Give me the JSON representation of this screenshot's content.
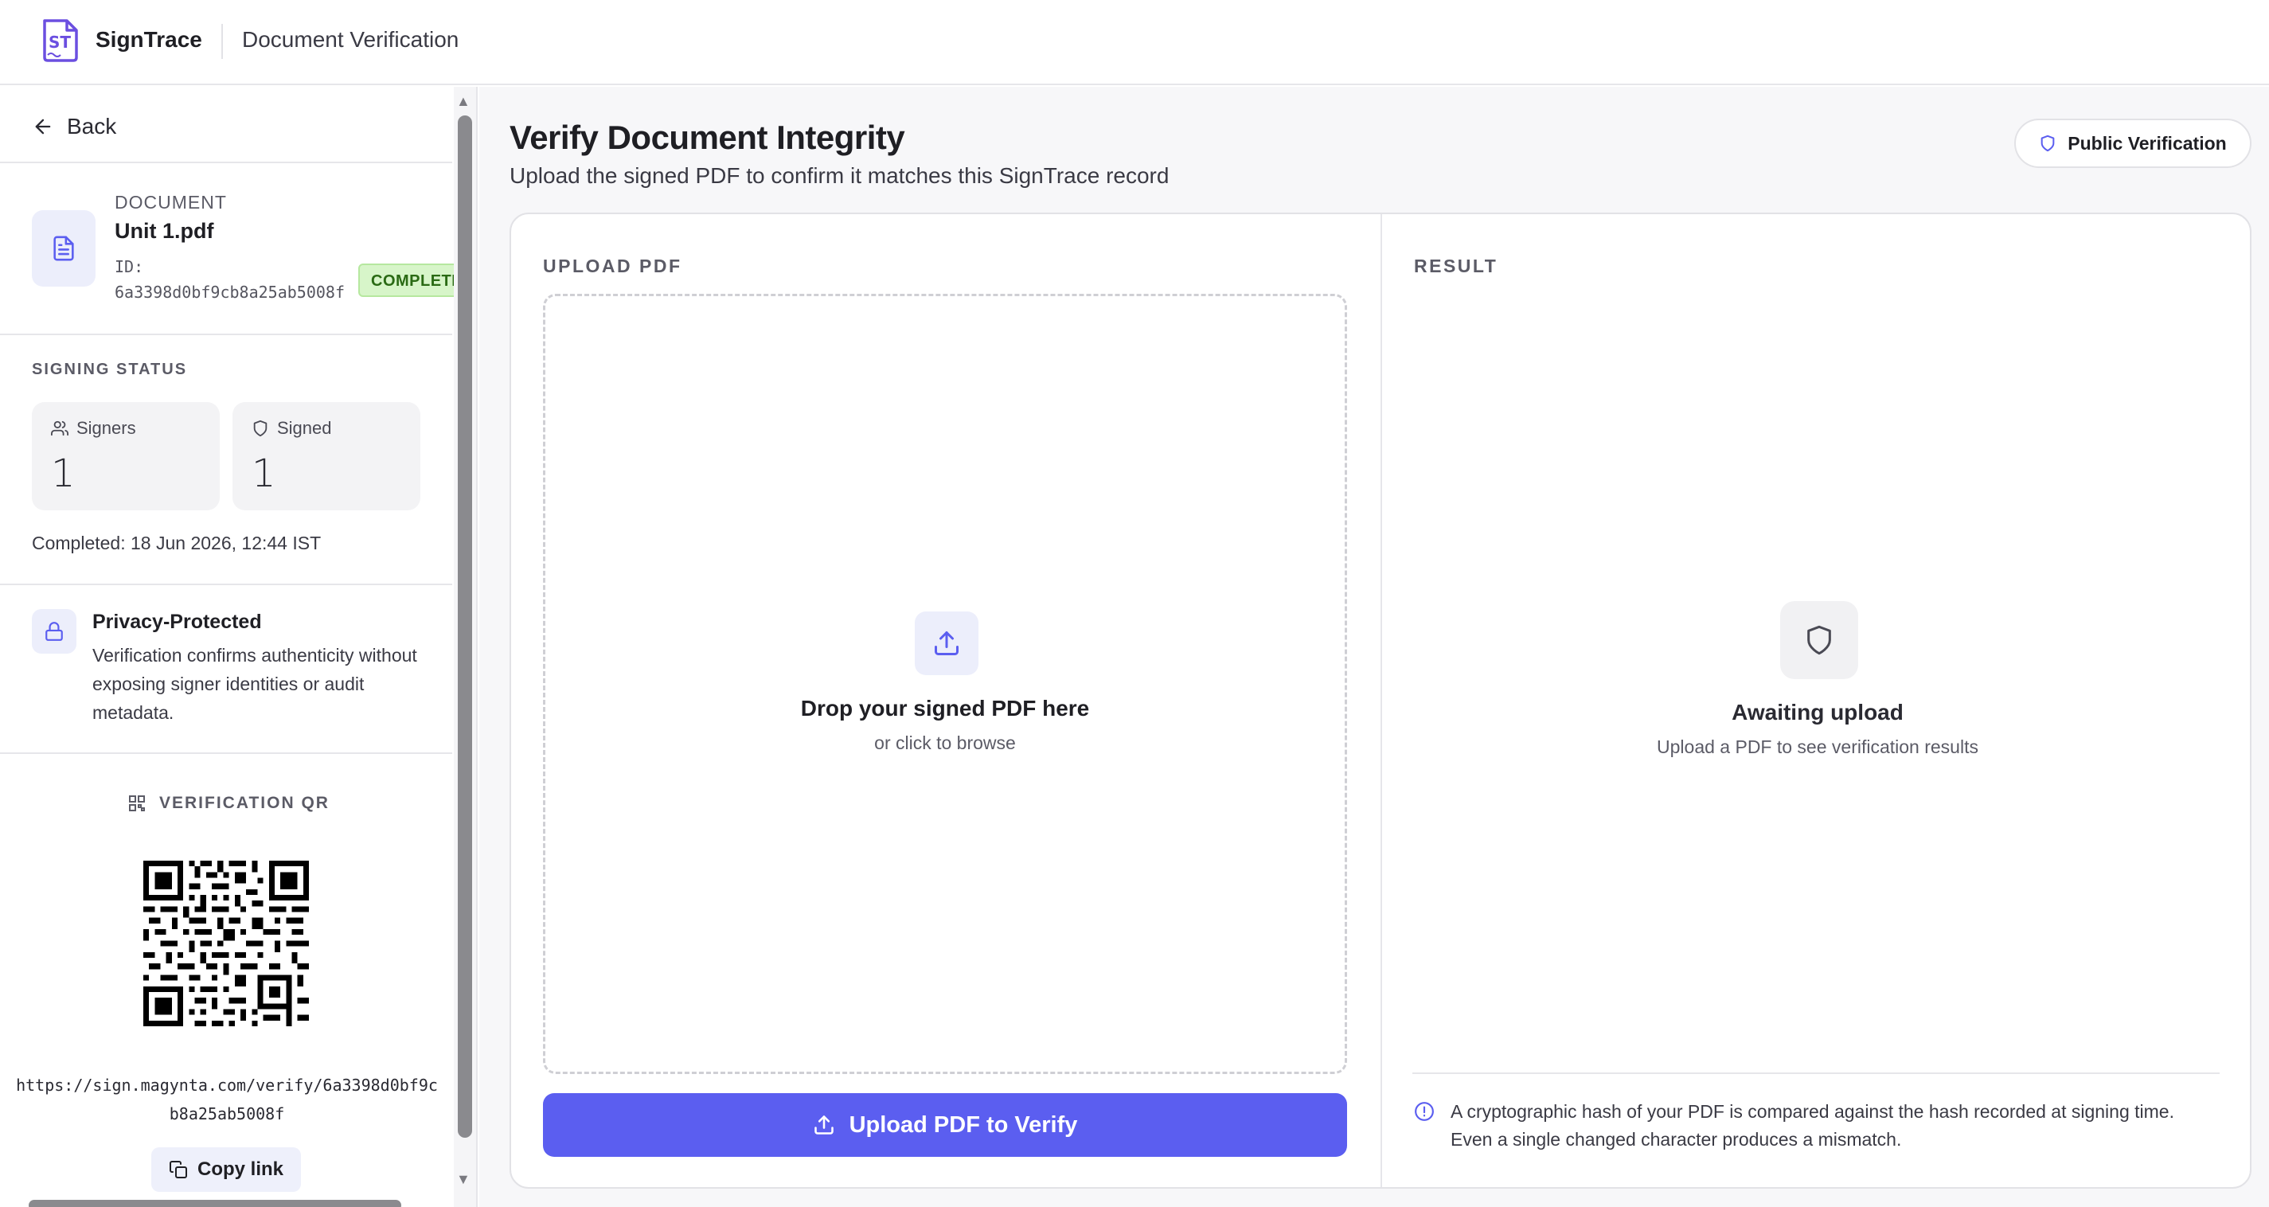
{
  "header": {
    "brand": "SignTrace",
    "subtitle": "Document Verification"
  },
  "sidebar": {
    "back_label": "Back",
    "document": {
      "label": "DOCUMENT",
      "name": "Unit 1.pdf",
      "id_label": "ID:",
      "id": "6a3398d0bf9cb8a25ab5008f",
      "status_badge": "COMPLETED"
    },
    "signing_status": {
      "title": "SIGNING STATUS",
      "signers_label": "Signers",
      "signers_value": "1",
      "signed_label": "Signed",
      "signed_value": "1",
      "completed": "Completed: 18 Jun 2026, 12:44 IST"
    },
    "privacy": {
      "title": "Privacy-Protected",
      "text": "Verification confirms authenticity without exposing signer identities or audit metadata."
    },
    "qr": {
      "title": "VERIFICATION QR",
      "url": "https://sign.magynta.com/verify/6a3398d0bf9cb8a25ab5008f",
      "copy_label": "Copy link"
    }
  },
  "main": {
    "title": "Verify Document Integrity",
    "subtitle": "Upload the signed PDF to confirm it matches this SignTrace record",
    "public_button": "Public Verification",
    "upload_panel": {
      "title": "UPLOAD PDF",
      "drop_title": "Drop your signed PDF here",
      "drop_sub": "or click to browse",
      "button": "Upload PDF to Verify"
    },
    "result_panel": {
      "title": "RESULT",
      "await_title": "Awaiting upload",
      "await_sub": "Upload a PDF to see verification results",
      "info": "A cryptographic hash of your PDF is compared against the hash recorded at signing time. Even a single changed character produces a mismatch."
    }
  },
  "colors": {
    "accent": "#5b5ef0",
    "badge_bg": "#d7f5c9",
    "badge_text": "#2a6a14"
  },
  "icons": {
    "logo": "signtrace-logo",
    "back": "arrow-left-icon",
    "document": "file-text-icon",
    "signers": "users-icon",
    "signed": "shield-icon",
    "privacy": "lock-icon",
    "qr": "qr-code-icon",
    "copy": "copy-icon",
    "public": "shield-icon",
    "upload": "upload-icon",
    "result": "shield-icon",
    "info": "info-icon"
  }
}
